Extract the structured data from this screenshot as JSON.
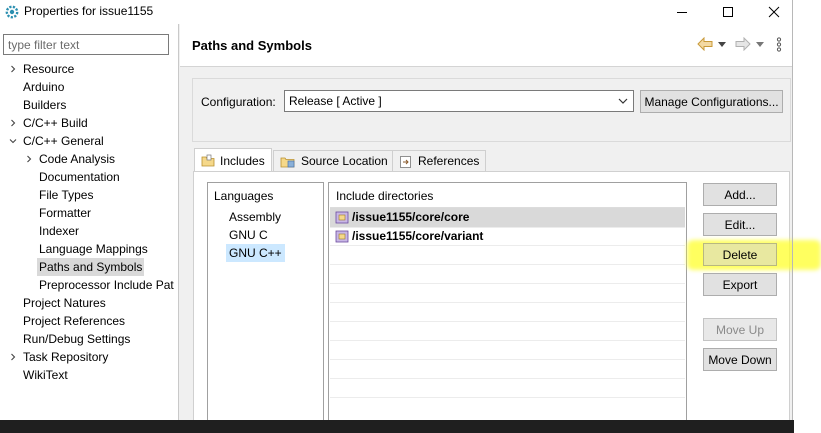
{
  "window": {
    "title": "Properties for issue1155",
    "controls": [
      "—",
      "☐",
      "✕"
    ]
  },
  "sidebar": {
    "filter_placeholder": "type filter text",
    "items": [
      {
        "label": "Resource",
        "arrow": "›"
      },
      {
        "label": "Arduino",
        "arrow": ""
      },
      {
        "label": "Builders",
        "arrow": ""
      },
      {
        "label": "C/C++ Build",
        "arrow": "›"
      },
      {
        "label": "C/C++ General",
        "arrow": "⌄"
      },
      {
        "label": "Code Analysis",
        "arrow": "›"
      },
      {
        "label": "Documentation",
        "arrow": ""
      },
      {
        "label": "File Types",
        "arrow": ""
      },
      {
        "label": "Formatter",
        "arrow": ""
      },
      {
        "label": "Indexer",
        "arrow": ""
      },
      {
        "label": "Language Mappings",
        "arrow": ""
      },
      {
        "label": "Paths and Symbols",
        "arrow": ""
      },
      {
        "label": "Preprocessor Include Pat",
        "arrow": ""
      },
      {
        "label": "Project Natures",
        "arrow": ""
      },
      {
        "label": "Project References",
        "arrow": ""
      },
      {
        "label": "Run/Debug Settings",
        "arrow": ""
      },
      {
        "label": "Task Repository",
        "arrow": "›"
      },
      {
        "label": "WikiText",
        "arrow": ""
      }
    ]
  },
  "main": {
    "title": "Paths and Symbols",
    "config_label": "Configuration:",
    "config_value": "Release  [ Active ]",
    "manage_button": "Manage Configurations...",
    "tabs": [
      {
        "label": "Includes"
      },
      {
        "label": "Source Location"
      },
      {
        "label": "References"
      }
    ],
    "languages_header": "Languages",
    "languages": [
      "Assembly",
      "GNU C",
      "GNU C++"
    ],
    "includes_header": "Include directories",
    "includes": [
      "/issue1155/core/core",
      "/issue1155/core/variant"
    ],
    "buttons": {
      "add": "Add...",
      "edit": "Edit...",
      "delete": "Delete",
      "export": "Export",
      "move_up": "Move Up",
      "move_down": "Move Down"
    }
  },
  "colors": {
    "highlight": "#ffff33",
    "selected_language": "#cce8ff",
    "selected_row": "#d9d9d9"
  }
}
